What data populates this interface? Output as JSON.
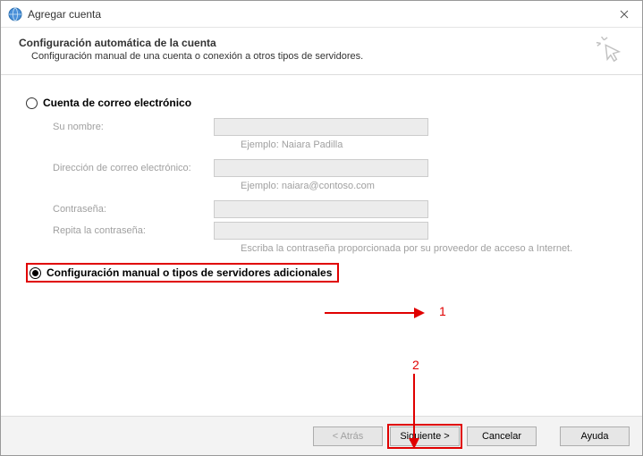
{
  "window": {
    "title": "Agregar cuenta"
  },
  "header": {
    "title": "Configuración automática de la cuenta",
    "subtitle": "Configuración manual de una cuenta o conexión a otros tipos de servidores."
  },
  "radio_email": {
    "label": "Cuenta de correo electrónico"
  },
  "fields": {
    "name_label": "Su nombre:",
    "name_hint": "Ejemplo: Naiara Padilla",
    "email_label": "Dirección de correo electrónico:",
    "email_hint": "Ejemplo: naiara@contoso.com",
    "password_label": "Contraseña:",
    "password2_label": "Repita la contraseña:",
    "password_hint": "Escriba la contraseña proporcionada por su proveedor de acceso a Internet."
  },
  "radio_manual": {
    "label": "Configuración manual o tipos de servidores adicionales"
  },
  "annotations": {
    "one": "1",
    "two": "2"
  },
  "buttons": {
    "back": "< Atrás",
    "next": "Siguiente >",
    "cancel": "Cancelar",
    "help": "Ayuda"
  }
}
